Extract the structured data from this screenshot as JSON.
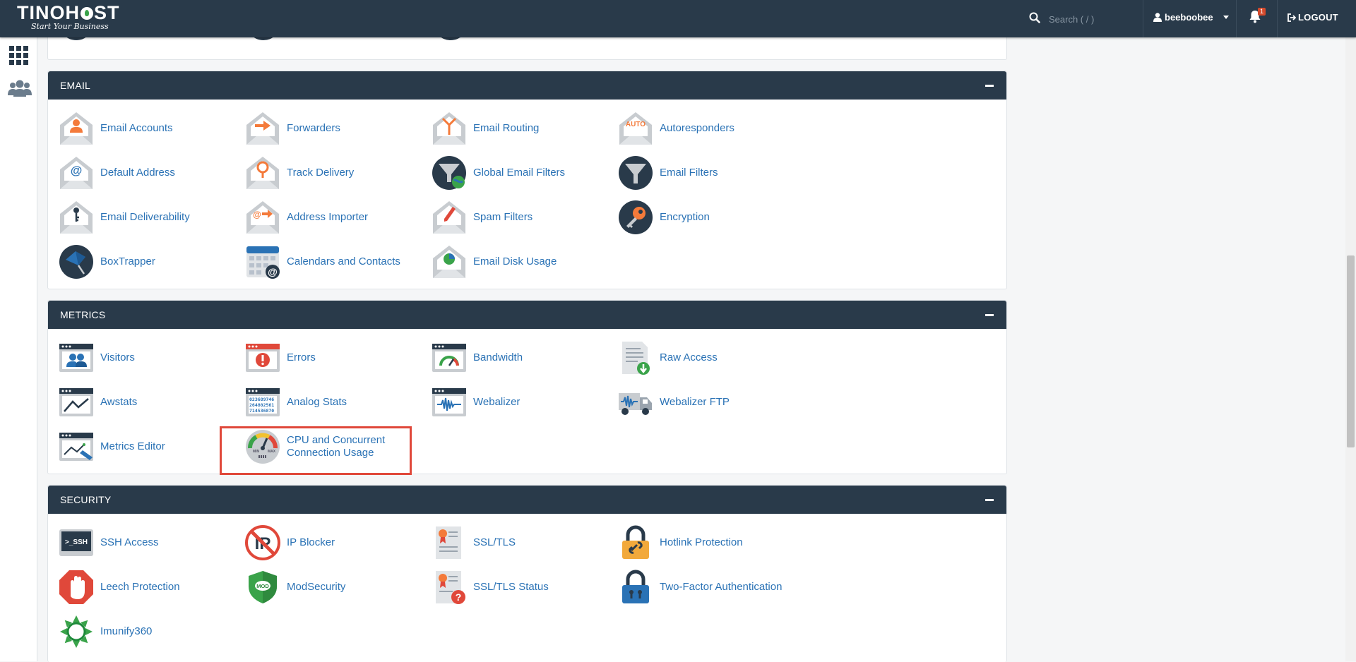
{
  "header": {
    "logo_text_left": "TINO",
    "logo_text_right": "ST",
    "logo_o": "H",
    "logo_tagline": "Start Your Business",
    "search_placeholder": "Search ( / )",
    "username": "beeboobee",
    "notification_count": "1",
    "logout_label": "LOGOUT"
  },
  "sections": {
    "email": {
      "title": "EMAIL",
      "items": [
        {
          "label": "Email Accounts"
        },
        {
          "label": "Forwarders"
        },
        {
          "label": "Email Routing"
        },
        {
          "label": "Autoresponders",
          "icon_text": "AUTO"
        },
        {
          "label": "Default Address"
        },
        {
          "label": "Track Delivery"
        },
        {
          "label": "Global Email Filters"
        },
        {
          "label": "Email Filters"
        },
        {
          "label": "Email Deliverability"
        },
        {
          "label": "Address Importer"
        },
        {
          "label": "Spam Filters"
        },
        {
          "label": "Encryption"
        },
        {
          "label": "BoxTrapper"
        },
        {
          "label": "Calendars and Contacts"
        },
        {
          "label": "Email Disk Usage"
        }
      ]
    },
    "metrics": {
      "title": "METRICS",
      "items": [
        {
          "label": "Visitors"
        },
        {
          "label": "Errors"
        },
        {
          "label": "Bandwidth"
        },
        {
          "label": "Raw Access"
        },
        {
          "label": "Awstats"
        },
        {
          "label": "Analog Stats"
        },
        {
          "label": "Webalizer"
        },
        {
          "label": "Webalizer FTP"
        },
        {
          "label": "Metrics Editor"
        },
        {
          "label": "CPU and Concurrent Connection Usage"
        }
      ]
    },
    "security": {
      "title": "SECURITY",
      "items": [
        {
          "label": "SSH Access",
          "icon_text": ">_SSH"
        },
        {
          "label": "IP Blocker"
        },
        {
          "label": "SSL/TLS"
        },
        {
          "label": "Hotlink Protection"
        },
        {
          "label": "Leech Protection"
        },
        {
          "label": "ModSecurity",
          "icon_text": "MOD"
        },
        {
          "label": "SSL/TLS Status"
        },
        {
          "label": "Two-Factor Authentication"
        },
        {
          "label": "Imunify360"
        }
      ]
    }
  },
  "colors": {
    "header_bg": "#293a4a",
    "link": "#2a72b5",
    "highlight": "#e0483a",
    "accent_orange": "#f47a3a"
  }
}
